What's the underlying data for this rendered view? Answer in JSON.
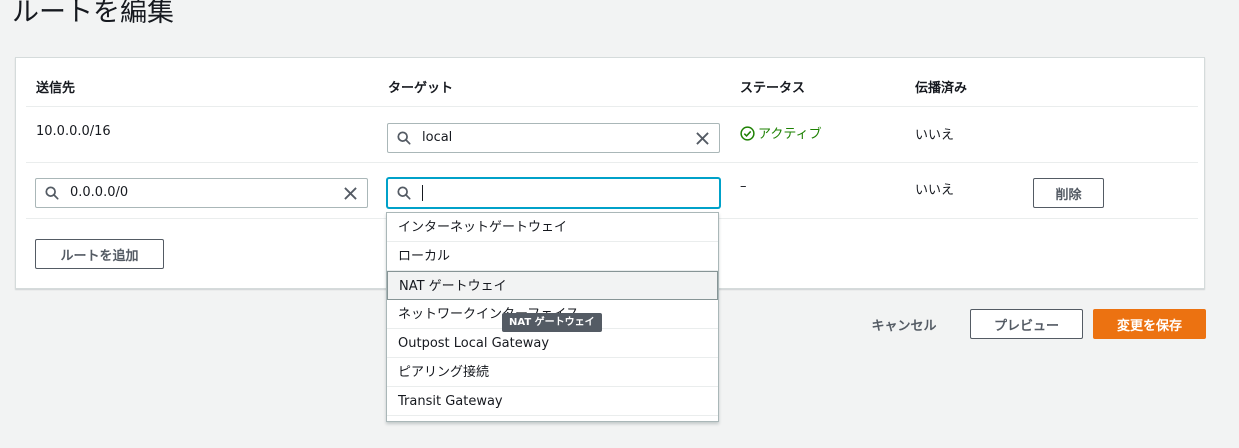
{
  "page": {
    "title": "ルートを編集"
  },
  "table": {
    "headers": {
      "destination": "送信先",
      "target": "ターゲット",
      "status": "ステータス",
      "propagated": "伝播済み"
    },
    "rows": [
      {
        "destination": "10.0.0.0/16",
        "target": "local",
        "status": "アクティブ",
        "propagated": "いいえ"
      },
      {
        "destination": "0.0.0.0/0",
        "target": "",
        "status": "–",
        "propagated": "いいえ",
        "remove_label": "削除"
      }
    ],
    "add_route_label": "ルートを追加"
  },
  "dropdown": {
    "options": [
      "インターネットゲートウェイ",
      "ローカル",
      "NAT ゲートウェイ",
      "ネットワークインターフェイス",
      "Outpost Local Gateway",
      "ピアリング接続",
      "Transit Gateway"
    ],
    "highlighted_index": 2,
    "tooltip": "NAT ゲートウェイ"
  },
  "footer": {
    "cancel_label": "キャンセル",
    "preview_label": "プレビュー",
    "save_label": "変更を保存"
  },
  "colors": {
    "accent": "#00a1c9",
    "primary_button": "#ec7211",
    "status_active": "#1d8102"
  },
  "icons": [
    "search-icon",
    "clear-icon",
    "check-circle-icon"
  ]
}
